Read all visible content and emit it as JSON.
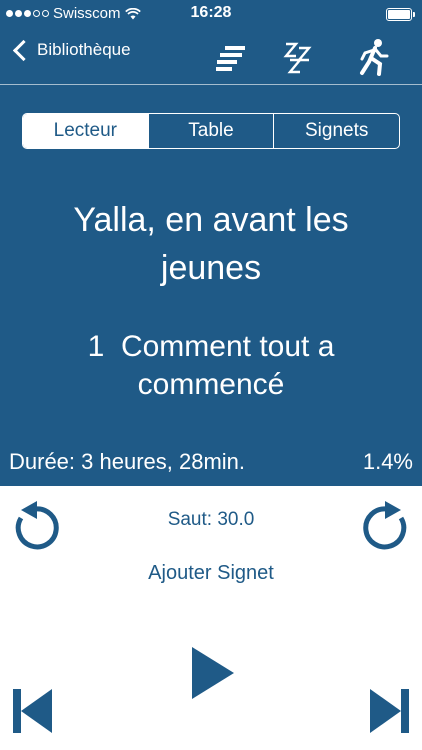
{
  "status_bar": {
    "carrier": "Swisscom",
    "time": "16:28",
    "signal_bars_filled": 3,
    "signal_bars_total": 5
  },
  "nav": {
    "back_label": "Bibliothèque",
    "icons": [
      "chapters-icon",
      "sleep-timer-icon",
      "running-figure-icon"
    ]
  },
  "segments": {
    "items": [
      "Lecteur",
      "Table",
      "Signets"
    ],
    "selected": "Lecteur"
  },
  "book": {
    "title": "Yalla, en avant les jeunes",
    "chapter_number": "1",
    "chapter_title": "Comment tout a commencé"
  },
  "progress": {
    "duration": "Durée: 3 heures, 28min.",
    "percent": "1.4%"
  },
  "controls": {
    "jump_label": "Saut: 30.0",
    "add_bookmark_label": "Ajouter Signet"
  },
  "colors": {
    "primary": "#1f5a87",
    "background": "#ffffff"
  }
}
